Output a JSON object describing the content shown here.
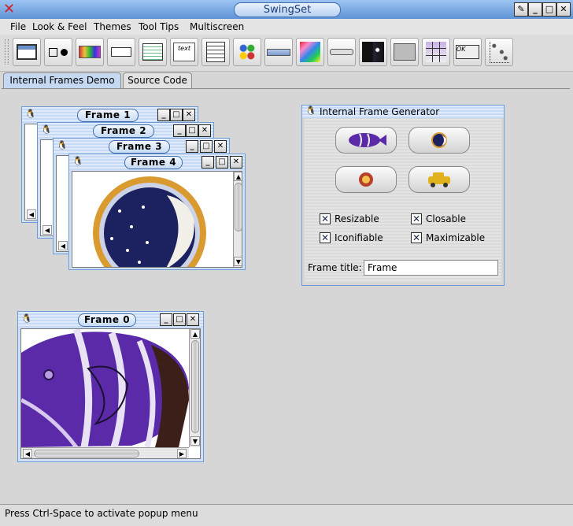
{
  "app": {
    "title": "SwingSet"
  },
  "menus": [
    "File",
    "Look & Feel",
    "Themes",
    "Tool Tips",
    "Multiscreen"
  ],
  "menu_mnemonics": [
    "F",
    "L",
    "T",
    "T",
    "M"
  ],
  "toolbar": {
    "icons": [
      "internal-frame-icon",
      "checkbox-radio-icon",
      "color-chooser-icon",
      "combobox-icon",
      "file-chooser-icon",
      "editor-pane-icon",
      "list-icon",
      "option-pane-icon",
      "progress-bar-icon",
      "scroll-pane-icon",
      "slider-icon",
      "split-pane-icon",
      "tabbed-pane-icon",
      "table-icon",
      "tooltip-icon",
      "tree-icon"
    ],
    "editor_glyph": "text",
    "tooltip_glyph": "OK"
  },
  "tabs": [
    {
      "label": "Internal Frames Demo",
      "selected": true
    },
    {
      "label": "Source Code",
      "selected": false
    }
  ],
  "frames": [
    {
      "title": "Frame 1"
    },
    {
      "title": "Frame 2"
    },
    {
      "title": "Frame 3"
    },
    {
      "title": "Frame 4",
      "image": "moon"
    },
    {
      "title": "Frame 0",
      "image": "fish"
    }
  ],
  "generator": {
    "title": "Internal Frame Generator",
    "buttons": [
      "fish-image-icon",
      "moon-image-icon",
      "sun-image-icon",
      "car-image-icon"
    ],
    "checkboxes": [
      {
        "label": "Resizable",
        "checked": true
      },
      {
        "label": "Closable",
        "checked": true
      },
      {
        "label": "Iconifiable",
        "checked": true
      },
      {
        "label": "Maximizable",
        "checked": true
      }
    ],
    "frame_title_label": "Frame title:",
    "frame_title_value": "Frame"
  },
  "status": "Press Ctrl-Space to activate popup menu",
  "colors": {
    "titlebar": "#5e93d6",
    "frame_border": "#6e9bd6",
    "fish_purple": "#5a2aa8"
  }
}
